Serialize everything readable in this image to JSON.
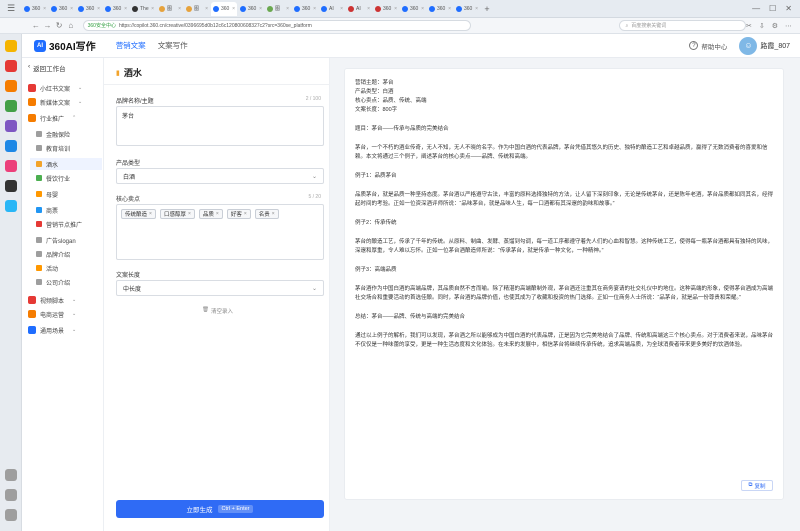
{
  "browser": {
    "tabs": [
      {
        "label": "360",
        "color": "#1f6dff",
        "active": false
      },
      {
        "label": "360",
        "color": "#1f6dff",
        "active": false
      },
      {
        "label": "360",
        "color": "#1f6dff",
        "active": false
      },
      {
        "label": "360",
        "color": "#1f6dff",
        "active": false
      },
      {
        "label": "The",
        "color": "#333333",
        "active": false
      },
      {
        "label": "图",
        "color": "#e6a23c",
        "active": false
      },
      {
        "label": "图",
        "color": "#e6a23c",
        "active": false
      },
      {
        "label": "360",
        "color": "#1f6dff",
        "active": true
      },
      {
        "label": "360",
        "color": "#1f6dff",
        "active": false
      },
      {
        "label": "图",
        "color": "#6aa84f",
        "active": false
      },
      {
        "label": "360",
        "color": "#1f6dff",
        "active": false
      },
      {
        "label": "AI",
        "color": "#1f6dff",
        "active": false
      },
      {
        "label": "AI",
        "color": "#cc3333",
        "active": false
      },
      {
        "label": "360",
        "color": "#cc3333",
        "active": false
      },
      {
        "label": "360",
        "color": "#1f6dff",
        "active": false
      },
      {
        "label": "360",
        "color": "#1f6dff",
        "active": false
      },
      {
        "label": "360",
        "color": "#1f6dff",
        "active": false
      }
    ],
    "url_secure_text": "360安全中心",
    "url": "https://copilot.360.cn/creative/0396695d0b12c6c120800608327c2?src=360se_platform",
    "search_placeholder": "百度搜索关键词"
  },
  "header": {
    "logo_badge": "AI",
    "app_name": "360AI写作",
    "tabs": [
      "营销文案",
      "文案写作"
    ],
    "help": "帮助中心",
    "username": "路霞_807"
  },
  "sidebar": {
    "back_label": "返回工作台",
    "items": [
      {
        "label": "小红书文案",
        "color": "#e53935",
        "sub": false,
        "caret": "⌄"
      },
      {
        "label": "新媒体文案",
        "color": "#f57c00",
        "sub": false,
        "caret": "⌄"
      },
      {
        "label": "行业推广",
        "color": "#f57c00",
        "sub": false,
        "caret": "⌃"
      },
      {
        "label": "金融保险",
        "color": "#9e9e9e",
        "sub": true,
        "caret": ""
      },
      {
        "label": "教育培训",
        "color": "#9e9e9e",
        "sub": true,
        "caret": ""
      },
      {
        "label": "酒水",
        "color": "#f2a32b",
        "sub": true,
        "caret": "",
        "active": true
      },
      {
        "label": "餐饮行业",
        "color": "#4caf50",
        "sub": true,
        "caret": ""
      },
      {
        "label": "母婴",
        "color": "#ff9800",
        "sub": true,
        "caret": ""
      },
      {
        "label": "商票",
        "color": "#2196f3",
        "sub": true,
        "caret": ""
      },
      {
        "label": "营销节点推广",
        "color": "#e53935",
        "sub": true,
        "caret": ""
      },
      {
        "label": "广告slogan",
        "color": "#9e9e9e",
        "sub": true,
        "caret": ""
      },
      {
        "label": "品牌介绍",
        "color": "#9e9e9e",
        "sub": true,
        "caret": ""
      },
      {
        "label": "活动",
        "color": "#ff9800",
        "sub": true,
        "caret": ""
      },
      {
        "label": "公司介绍",
        "color": "#9e9e9e",
        "sub": true,
        "caret": ""
      },
      {
        "label": "视频脚本",
        "color": "#e53935",
        "sub": false,
        "caret": "⌄"
      },
      {
        "label": "电商运营",
        "color": "#f57c00",
        "sub": false,
        "caret": "⌄"
      },
      {
        "label": "通用场景",
        "color": "#1f6dff",
        "sub": false,
        "caret": "⌄"
      }
    ]
  },
  "form": {
    "title": "酒水",
    "name_label": "品牌名称/主题",
    "name_count": "2 / 100",
    "name_value": "茅台",
    "type_label": "产品类型",
    "type_value": "白酒",
    "keywords_label": "核心卖点",
    "keywords_count": "5 / 20",
    "tags": [
      "传统酿造",
      "口感醇厚",
      "品质",
      "好客",
      "名贵"
    ],
    "length_label": "文案长度",
    "length_value": "中长度",
    "clear_label": "清空录入",
    "generate_label": "立即生成",
    "generate_shortcut": "Ctrl + Enter"
  },
  "result": {
    "lines": [
      "营销主题：茅台",
      "产品类型：白酒",
      "核心卖点：品质、传统、高端",
      "文案长度：800字",
      "",
      "题目：茅台——传承与品质的完美结合",
      "",
      "茅台，一个不朽的酒业传奇，无人不知，无人不晓的名字。作为中国白酒的代表品牌，茅台凭借其悠久的历史、独特的酿造工艺和卓越品质，赢得了无数消费者的喜爱和信赖。本文将通过三个例子，阐述茅台的核心卖点——品牌、传统和高端。",
      "",
      "例子1：品质茅台",
      "",
      "品质茅台，就是品质一种坚持态度。茅台酒以严格遵守古法，丰富的原料选择独特的方法，让人留下深刻印象，无论是传统茅台，还是陈年老酒，茅台品质都如同其名，经得起时间的考验。正如一位资深酒评师所说：“品味茅台，就是品味人生，每一口酒都有其深邃的韵味和故事。”",
      "",
      "例子2：传承传统",
      "",
      "茅台的酿造工艺，传承了千年的传统。从原料、制曲、发酵、蒸馏到勾调，每一道工序都遵守着先人们的心血和智慧。这种传统工艺，使得每一瓶茅台酒都具有独特的风味，深邃和厚重，令人难以忘怀。正如一位茅台酒酿造师所说：“传承茅台，就是传承一种文化，一种精神。”",
      "",
      "例子3：高端品质",
      "",
      "茅台酒作为中国白酒的高端品牌，其品质自然不言而喻。除了精湛的高端酿制外观，茅台酒还注重其在商务宴请的社交礼仪中的地位。这种高端的形象，使得茅台酒成为高端社交场合和重要活动的首选佳酿。同时，茅台酒的品牌价值，也使其成为了收藏和投资的热门选择。正如一位商务人士所说：“品茅台，就是品一份尊贵和荣耀。”",
      "",
      "总结：茅台——品牌、传统与高端的完美结合",
      "",
      "通过以上例子的解析，我们可以发现，茅台酒之所以能够成为中国白酒的代表品牌，正是因为它完美地结合了品牌、传统和高端这三个核心卖点。对于消费者来说，品味茅台不仅仅是一种味蕾的享受，更是一种生活态度和文化体验。在未来的发展中，相信茅台将继续传承传统，追求高端品质，为全球消费者带来更多美好的饮酒体验。"
    ],
    "copy_label": "复制"
  }
}
